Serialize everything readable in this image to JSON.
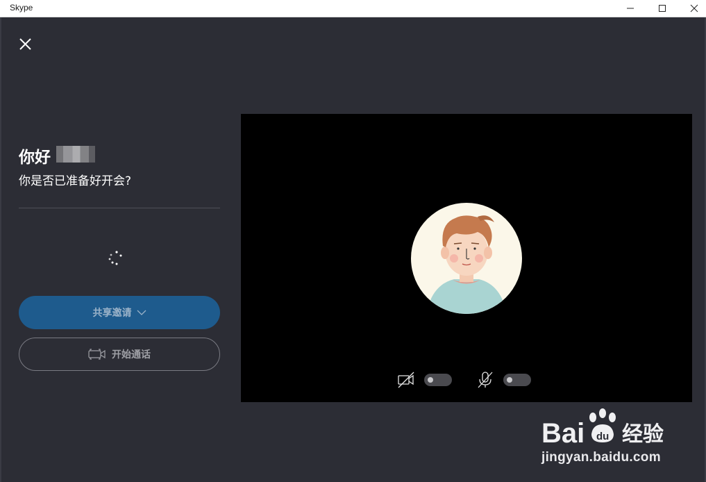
{
  "window": {
    "title": "Skype"
  },
  "greeting": {
    "hello": "你好",
    "question": "你是否已准备好开会?"
  },
  "buttons": {
    "share_label": "共享邀请",
    "start_label": "开始通话"
  },
  "video_controls": {
    "camera_on": false,
    "mic_on": false
  },
  "icons": [
    "close-icon",
    "spinner-icon",
    "chevron-down-icon",
    "video-camera-icon",
    "camera-off-icon",
    "microphone-off-icon"
  ],
  "colors": {
    "background": "#2c2d35",
    "share_button": "#1e5b8d",
    "video_bg": "#000000"
  },
  "watermark": {
    "brand": "Baidu经验",
    "url": "jingyan.baidu.com"
  }
}
